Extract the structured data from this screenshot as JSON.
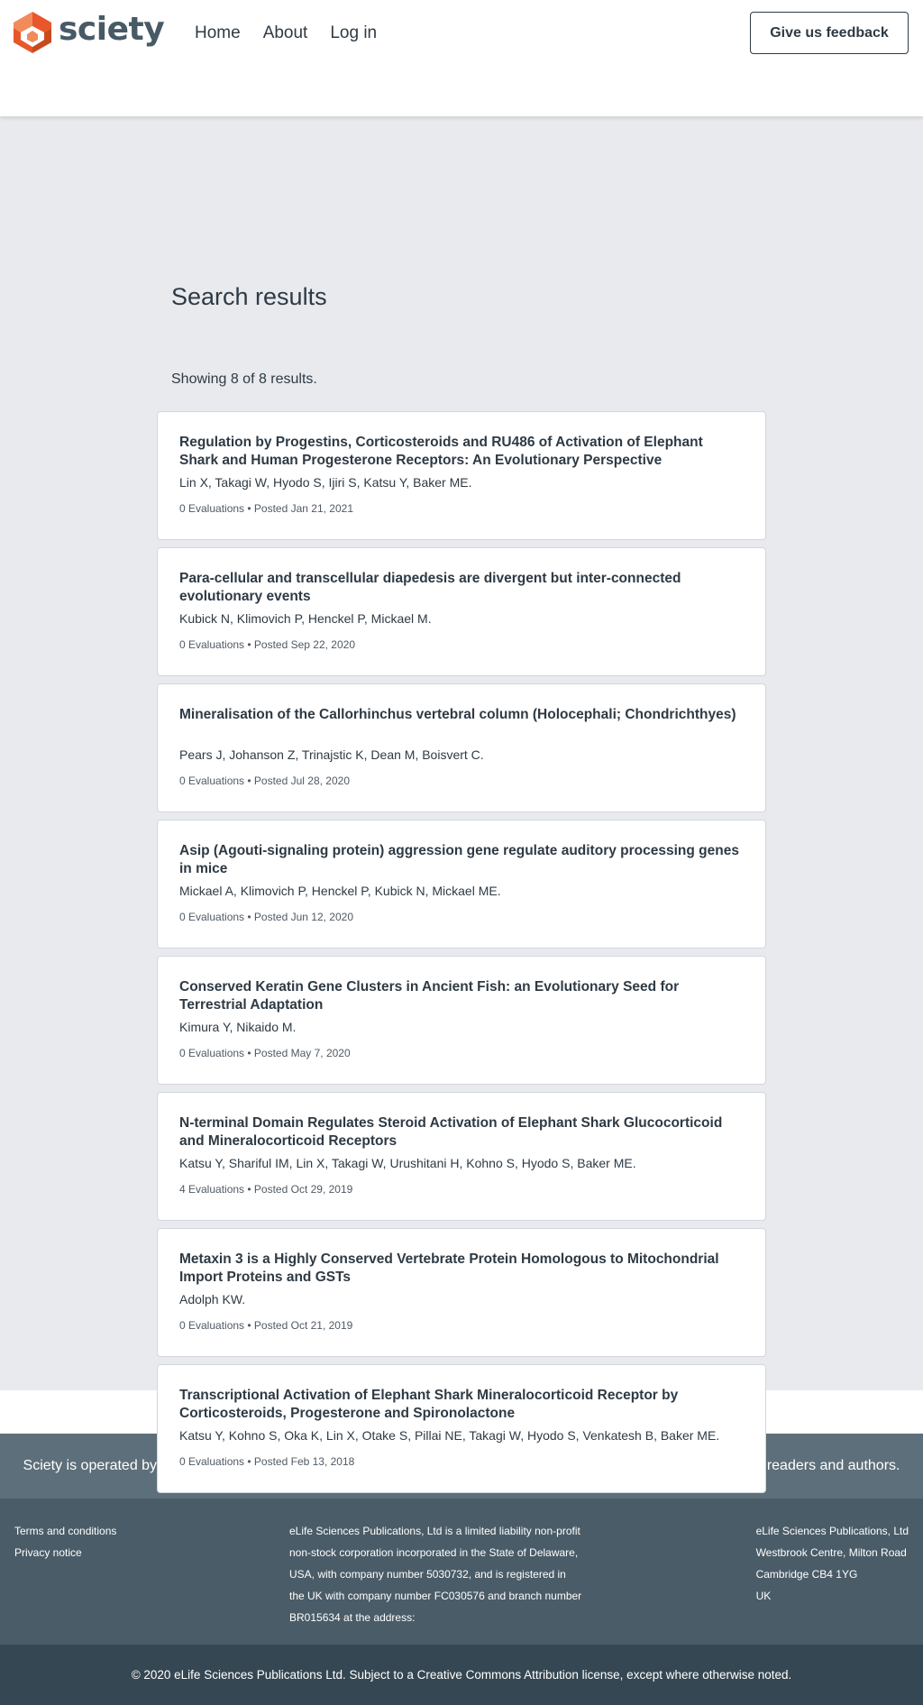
{
  "header": {
    "logo_text": "sciety",
    "nav": [
      "Home",
      "About",
      "Log in"
    ],
    "feedback_label": "Give us feedback"
  },
  "page_title": "Search results",
  "result_count": "Showing 8 of 8 results.",
  "results": [
    {
      "title": "Regulation by Progestins, Corticosteroids and RU486 of Activation of Elephant Shark and Human Progesterone Receptors: An Evolutionary Perspective",
      "authors": "Lin X, Takagi W, Hyodo S, Ijiri S, Katsu Y, Baker ME.",
      "meta": "0 Evaluations • Posted Jan 21, 2021"
    },
    {
      "title": "Para-cellular and transcellular diapedesis are divergent but inter-connected evolutionary events",
      "authors": "Kubick N, Klimovich P, Henckel P, Mickael M.",
      "meta": "0 Evaluations • Posted Sep 22, 2020"
    },
    {
      "title": "Mineralisation of the Callorhinchus vertebral column (Holocephali; Chondrichthyes)",
      "authors": "Pears J, Johanson Z, Trinajstic K, Dean M, Boisvert C.",
      "meta": "0 Evaluations • Posted Jul 28, 2020"
    },
    {
      "title": "Asip (Agouti-signaling protein) aggression gene regulate auditory processing genes in mice",
      "authors": "Mickael A, Klimovich P, Henckel P, Kubick N, Mickael ME.",
      "meta": "0 Evaluations • Posted Jun 12, 2020"
    },
    {
      "title": "Conserved Keratin Gene Clusters in Ancient Fish: an Evolutionary Seed for Terrestrial Adaptation",
      "authors": "Kimura Y, Nikaido M.",
      "meta": "0 Evaluations • Posted May 7, 2020"
    },
    {
      "title": "N-terminal Domain Regulates Steroid Activation of Elephant Shark Glucocorticoid and Mineralocorticoid Receptors",
      "authors": "Katsu Y, Shariful IM, Lin X, Takagi W, Urushitani H, Kohno S, Hyodo S, Baker ME.",
      "meta": "4 Evaluations • Posted Oct 29, 2019"
    },
    {
      "title": "Metaxin 3 is a Highly Conserved Vertebrate Protein Homologous to Mitochondrial Import Proteins and GSTs",
      "authors": "Adolph KW.",
      "meta": "0 Evaluations • Posted Oct 21, 2019"
    },
    {
      "title": "Transcriptional Activation of Elephant Shark Mineralocorticoid Receptor by Corticosteroids, Progesterone and Spironolactone",
      "authors": "Katsu Y, Kohno S, Oka K, Lin X, Otake S, Pillai NE, Takagi W, Hyodo S, Venkatesh B, Baker ME.",
      "meta": "0 Evaluations • Posted Feb 13, 2018"
    }
  ],
  "footer": {
    "banner": "Sciety is operated by a team based within eLife Sciences Publications Limited. It is steered by all of its communities, readers and authors.",
    "links": [
      "Terms and conditions",
      "Privacy notice"
    ],
    "legal": "eLife Sciences Publications, Ltd is a limited liability non-profit non-stock corporation incorporated in the State of Delaware, USA, with company number 5030732, and is registered in the UK with company number FC030576 and branch number BR015634 at the address:",
    "address": [
      "eLife Sciences Publications, Ltd",
      "Westbrook Centre, Milton Road",
      "Cambridge CB4 1YG",
      "UK"
    ],
    "copyright": "© 2020 eLife Sciences Publications Ltd. Subject to a Creative Commons Attribution license, except where otherwise noted."
  },
  "colors": {
    "logo_orange": "#e8562a",
    "logo_dark_orange": "#c84b1e",
    "logo_light_orange": "#f28b5c",
    "page_background": "#e9eaee",
    "text": "#2e3a44"
  }
}
